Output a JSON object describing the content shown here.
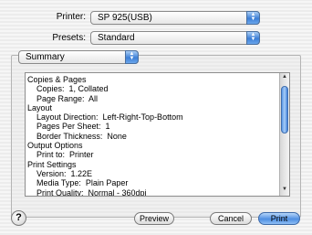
{
  "printer": {
    "label": "Printer:",
    "value": "SP 925(USB)"
  },
  "presets": {
    "label": "Presets:",
    "value": "Standard"
  },
  "section_menu": {
    "value": "Summary"
  },
  "summary_lines": [
    "Copies & Pages",
    "    Copies:  1, Collated",
    "    Page Range:  All",
    "Layout",
    "    Layout Direction:  Left-Right-Top-Bottom",
    "    Pages Per Sheet:  1",
    "    Border Thickness:  None",
    "Output Options",
    "    Print to:  Printer",
    "Print Settings",
    "    Version:  1.22E",
    "    Media Type:  Plain Paper",
    "    Print Quality:  Normal - 360dpi"
  ],
  "buttons": {
    "help": "?",
    "preview": "Preview",
    "cancel": "Cancel",
    "print": "Print"
  },
  "icons": {
    "popup_arrows": "up-down-arrows-icon",
    "help": "question-mark-icon"
  }
}
